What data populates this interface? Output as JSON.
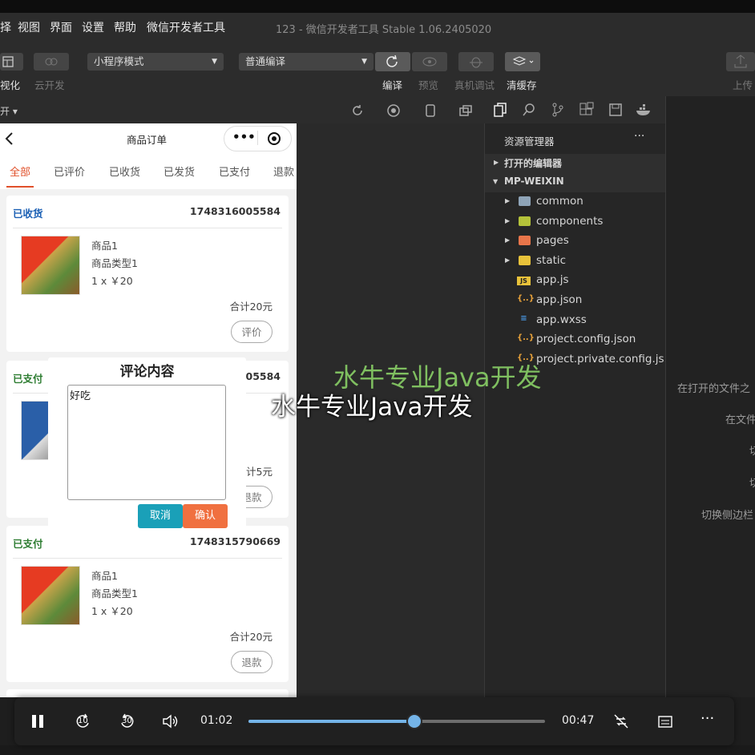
{
  "menubar": {
    "items": [
      "择",
      "视图",
      "界面",
      "设置",
      "帮助",
      "微信开发者工具"
    ],
    "window_title": "123 - 微信开发者工具 Stable 1.06.2405020"
  },
  "toolbar": {
    "left_labels": [
      "视化",
      "云开发"
    ],
    "mode_select": "小程序模式",
    "compile_select": "普通编译",
    "actions": [
      "编译",
      "预览",
      "真机调试",
      "清缓存"
    ],
    "upload": "上传"
  },
  "subbar": {
    "label": "开"
  },
  "phone": {
    "nav_title": "商品订单",
    "tabs": [
      "全部",
      "已评价",
      "已收货",
      "已发货",
      "已支付",
      "退款"
    ],
    "orders": [
      {
        "status": "已收货",
        "status_color": "#1a5fb4",
        "order_no": "1748316005584",
        "name": "商品1",
        "type": "商品类型1",
        "qty_price": "1 x ￥20",
        "total": "合计20元",
        "action": "评价"
      },
      {
        "status": "已支付",
        "status_color": "#2e7d32",
        "order_no": "005584",
        "name": "",
        "type": "",
        "qty_price": "",
        "total": "计5元",
        "action": "退款"
      },
      {
        "status": "已支付",
        "status_color": "#2e7d32",
        "order_no": "1748315790669",
        "name": "商品1",
        "type": "商品类型1",
        "qty_price": "1 x ￥20",
        "total": "合计20元",
        "action": "退款"
      }
    ]
  },
  "modal": {
    "title": "评论内容",
    "text_value": "好吃",
    "cancel": "取消",
    "confirm": "确认"
  },
  "explorer": {
    "title": "资源管理器",
    "more": "···",
    "open_editors": "打开的编辑器",
    "project": "MP-WEIXIN",
    "items": [
      {
        "label": "common",
        "type": "folder",
        "icon_color": "#8fa4b8"
      },
      {
        "label": "components",
        "type": "folder",
        "icon_color": "#b4c23a"
      },
      {
        "label": "pages",
        "type": "folder",
        "icon_color": "#e8754a"
      },
      {
        "label": "static",
        "type": "folder",
        "icon_color": "#e8c23a"
      },
      {
        "label": "app.js",
        "type": "file",
        "icon_text": "JS",
        "icon_color": "#e8c23a"
      },
      {
        "label": "app.json",
        "type": "file",
        "icon_text": "{..}",
        "icon_color": "#e8a23a"
      },
      {
        "label": "app.wxss",
        "type": "file",
        "icon_text": "≡",
        "icon_color": "#4a9ae8"
      },
      {
        "label": "project.config.json",
        "type": "file",
        "icon_text": "{..}",
        "icon_color": "#e8a23a"
      },
      {
        "label": "project.private.config.js...",
        "type": "file",
        "icon_text": "{..}",
        "icon_color": "#e8a23a"
      }
    ]
  },
  "right_pane": {
    "hints": [
      "在打开的文件之",
      "在文件",
      "切",
      "切",
      "切换侧边栏"
    ]
  },
  "watermark": {
    "line1": "水牛专业Java开发",
    "line2": "水牛专业Java开发"
  },
  "player": {
    "elapsed": "01:02",
    "remaining": "00:47",
    "progress": 0.56,
    "rewind_label": "10",
    "forward_label": "30"
  },
  "colors": {
    "accent": "#e0502a",
    "cancel_btn": "#1aa0b8",
    "confirm_btn": "#f07040"
  }
}
